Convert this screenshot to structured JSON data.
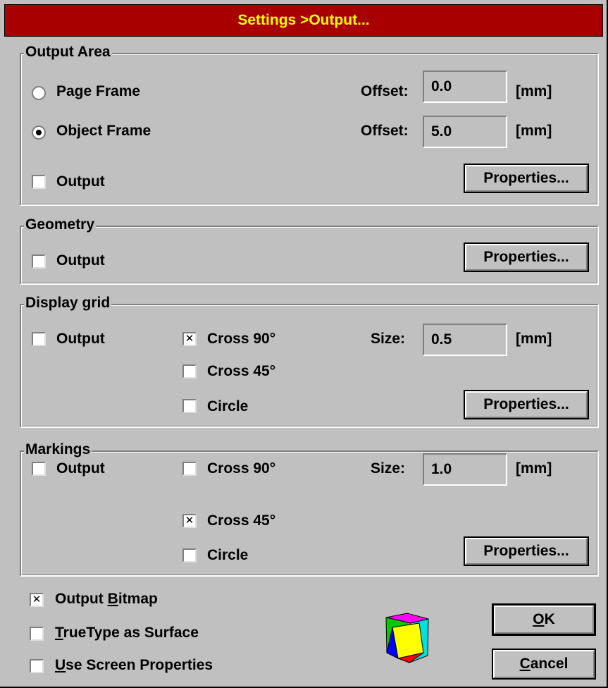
{
  "title": "Settings >Output...",
  "output_area": {
    "label": "Output Area",
    "page_frame_label": "Page Frame",
    "object_frame_label": "Object Frame",
    "selected": "object_frame",
    "offset1_label": "Offset:",
    "offset1_value": "0.0",
    "offset1_unit": "[mm]",
    "offset2_label": "Offset:",
    "offset2_value": "5.0",
    "offset2_unit": "[mm]",
    "output_label": "Output",
    "output_checked": false,
    "properties_label": "Properties..."
  },
  "geometry": {
    "label": "Geometry",
    "output_label": "Output",
    "output_checked": false,
    "properties_label": "Properties..."
  },
  "display_grid": {
    "label": "Display grid",
    "output_label": "Output",
    "output_checked": false,
    "cross90_label": "Cross 90°",
    "cross90_checked": true,
    "cross45_label": "Cross 45°",
    "cross45_checked": false,
    "circle_label": "Circle",
    "circle_checked": false,
    "size_label": "Size:",
    "size_value": "0.5",
    "size_unit": "[mm]",
    "properties_label": "Properties..."
  },
  "markings": {
    "label": "Markings",
    "output_label": "Output",
    "output_checked": false,
    "cross90_label": "Cross 90°",
    "cross90_checked": false,
    "cross45_label": "Cross 45°",
    "cross45_checked": true,
    "circle_label": "Circle",
    "circle_checked": false,
    "size_label": "Size:",
    "size_value": "1.0",
    "size_unit": "[mm]",
    "properties_label": "Properties..."
  },
  "bottom": {
    "output_bitmap": {
      "prefix": "Output ",
      "hotkey": "B",
      "suffix": "itmap",
      "checked": true
    },
    "truetype": {
      "prefix": "",
      "hotkey": "T",
      "suffix": "rueType as Surface",
      "checked": false
    },
    "screen_props": {
      "prefix": "",
      "hotkey": "U",
      "suffix": "se Screen Properties",
      "checked": false
    },
    "logo_icon": "cube-icon"
  },
  "buttons": {
    "ok": {
      "hotkey": "O",
      "suffix": "K"
    },
    "cancel": {
      "hotkey": "C",
      "suffix": "ancel"
    }
  },
  "colors": {
    "title_bg": "#a80000",
    "title_fg": "#ffff00",
    "dialog_bg": "#c0c0c0"
  }
}
